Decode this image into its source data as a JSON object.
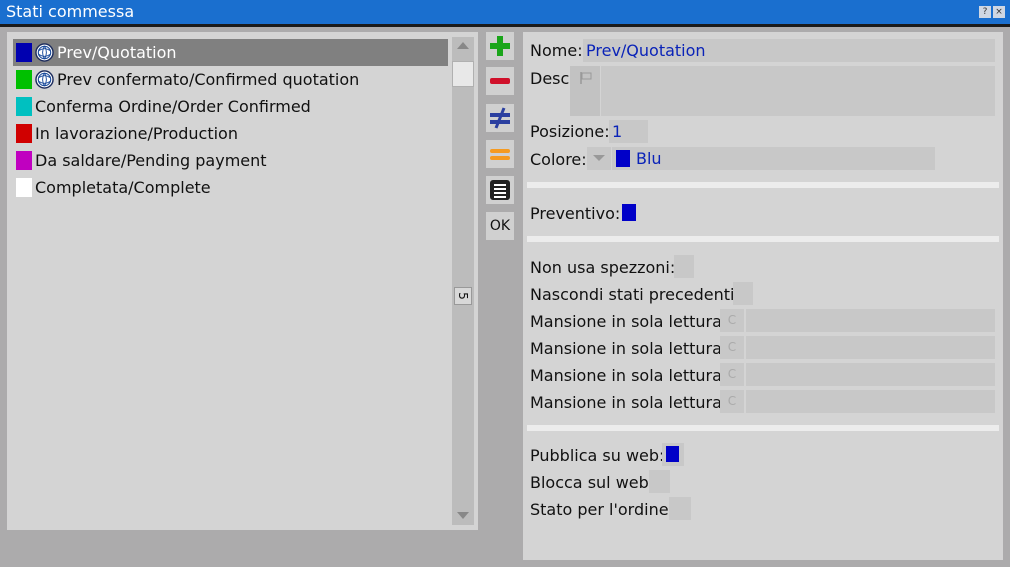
{
  "window": {
    "title": "Stati commessa",
    "help_btn": "?",
    "close_btn": "×"
  },
  "list": {
    "items": [
      {
        "label": "Prev/Quotation",
        "color": "#0000b0",
        "web": true,
        "selected": true
      },
      {
        "label": "Prev confermato/Confirmed quotation",
        "color": "#00c000",
        "web": true,
        "selected": false
      },
      {
        "label": "Conferma Ordine/Order Confirmed",
        "color": "#00c0c0",
        "web": false,
        "selected": false
      },
      {
        "label": "In lavorazione/Production",
        "color": "#d00000",
        "web": false,
        "selected": false
      },
      {
        "label": "Da saldare/Pending payment",
        "color": "#c000c0",
        "web": false,
        "selected": false
      },
      {
        "label": "Completata/Complete",
        "color": "#ffffff",
        "web": false,
        "selected": false
      }
    ],
    "count": "5"
  },
  "toolbar": {
    "ok_label": "OK"
  },
  "detail": {
    "nome_label": "Nome:",
    "nome_value": "Prev/Quotation",
    "desc_label": "Desc:",
    "posizione_label": "Posizione:",
    "posizione_value": "1",
    "colore_label": "Colore:",
    "colore_value": "Blu",
    "colore_color": "#0000c8",
    "preventivo_label": "Preventivo:",
    "non_usa_label": "Non usa spezzoni:",
    "nascondi_label": "Nascondi stati precedenti:",
    "mansioni": [
      {
        "label": "Mansione in sola lettura:",
        "btn": "C"
      },
      {
        "label": "Mansione in sola lettura:",
        "btn": "C"
      },
      {
        "label": "Mansione in sola lettura:",
        "btn": "C"
      },
      {
        "label": "Mansione in sola lettura:",
        "btn": "C"
      }
    ],
    "pubblica_label": "Pubblica su web:",
    "blocca_label": "Blocca sul web:",
    "stato_ordine_label": "Stato per l'ordine:"
  }
}
